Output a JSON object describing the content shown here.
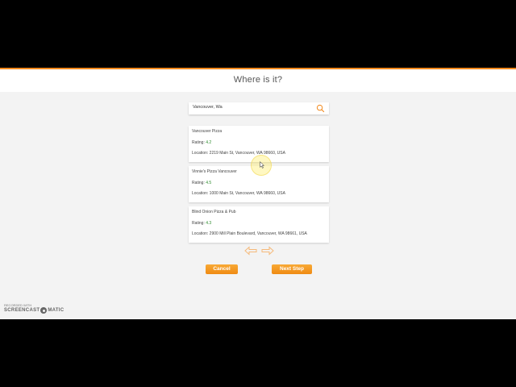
{
  "header": {
    "title": "Where is it?"
  },
  "search": {
    "value": "Vancouver, Wa"
  },
  "results": [
    {
      "name": "Vancouver Pizza",
      "rating_label": "Rating: ",
      "rating": "4.2",
      "location": "Location: 2219 Main St, Vancouver, WA 98660, USA"
    },
    {
      "name": "Vinnie's Pizza Vancouver",
      "rating_label": "Rating: ",
      "rating": "4.5",
      "location": "Location: 1000 Main St, Vancouver, WA 98660, USA"
    },
    {
      "name": "Blind Onion Pizza & Pub",
      "rating_label": "Rating: ",
      "rating": "4.3",
      "location": "Location: 2900 Mill Plain Boulevard, Vancouver, WA 98661, USA"
    }
  ],
  "nav": {
    "prev_icon": "arrow-left-icon",
    "next_icon": "arrow-right-icon"
  },
  "actions": {
    "cancel_label": "Cancel",
    "next_label": "Next Step"
  },
  "watermark": {
    "line1": "RECORDED WITH",
    "brand_left": "SCREENCAST",
    "brand_right": "MATIC"
  },
  "colors": {
    "accent": "#f28a1e",
    "button": "#f39a25",
    "rating": "#2c8a2c",
    "background": "#f3f3f3"
  }
}
